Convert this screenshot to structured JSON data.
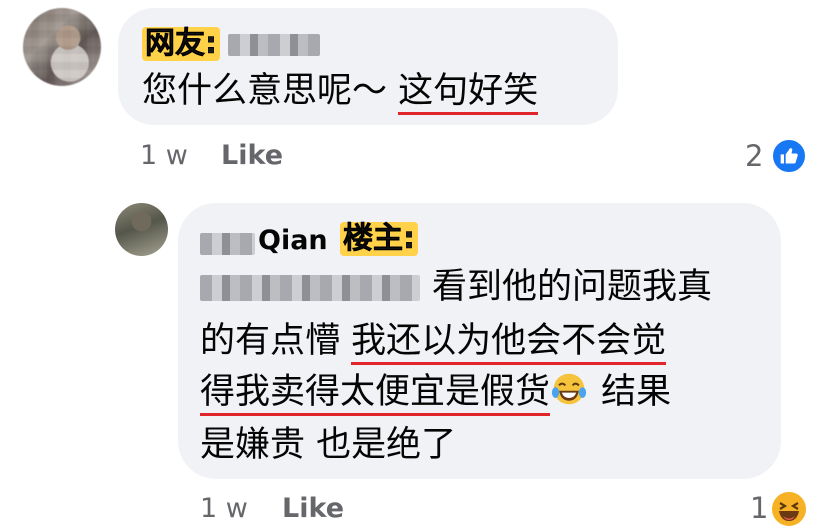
{
  "comment1": {
    "tag": "网友:",
    "text_plain": "您什么意思呢～ ",
    "text_highlight": "这句好笑",
    "time": "1 w",
    "like_label": "Like",
    "reaction_count": "2",
    "reaction_icon": "like-icon"
  },
  "comment2": {
    "name": "Qian",
    "tag": "楼主:",
    "line1_text": "看到他的问题我真",
    "line2_plain": "的有点懵 ",
    "line2_highlight": "我还以为他会不会觉",
    "line3_highlight": "得我卖得太便宜是假货",
    "line3_plain": " 结果",
    "line4_text": "是嫌贵 也是绝了",
    "time": "1 w",
    "like_label": "Like",
    "reaction_count": "1",
    "reaction_icon": "haha-icon"
  },
  "colors": {
    "bubble": "#f0f2f5",
    "underline": "#e0242a",
    "tag_bg": "#ffd24a",
    "meta": "#65676b",
    "like_blue": "#1877f2"
  }
}
